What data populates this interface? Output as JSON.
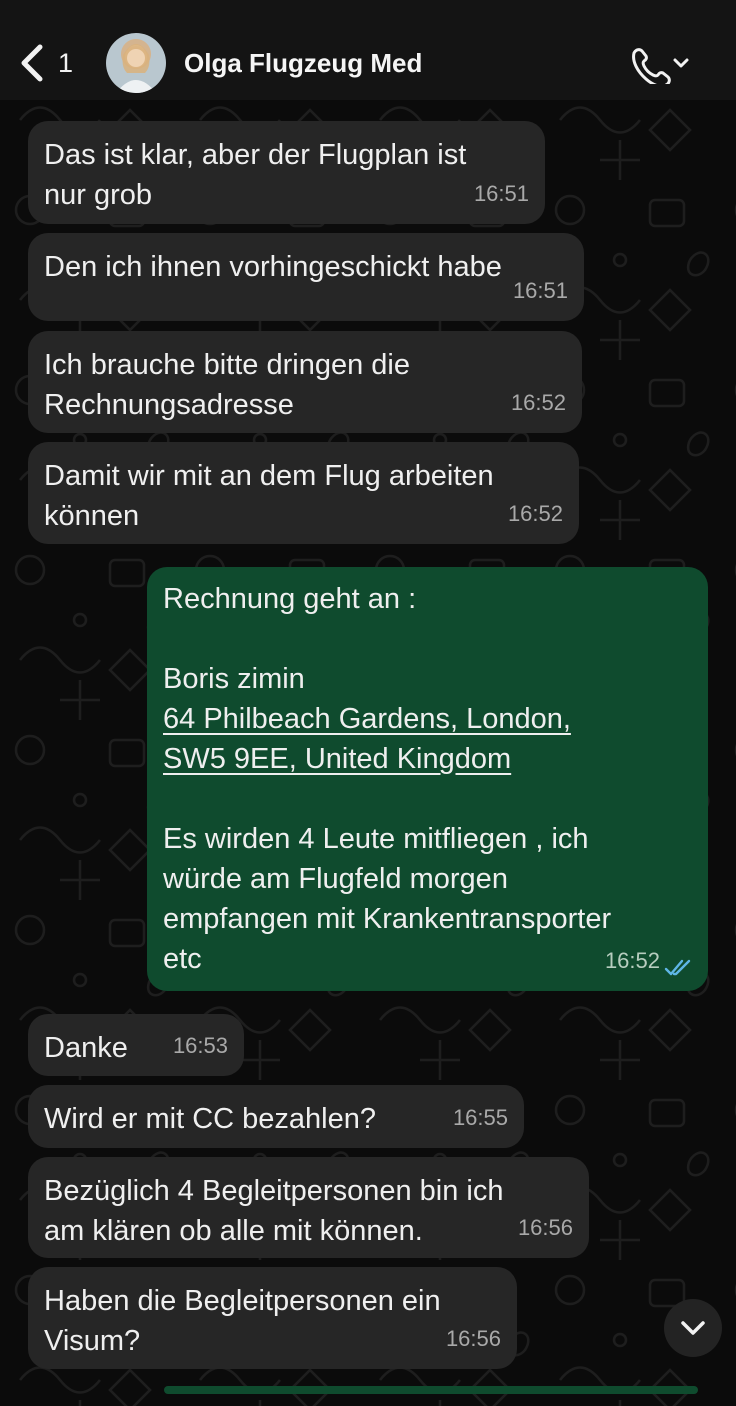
{
  "header": {
    "back_count": "1",
    "contact_name": "Olga Flugzeug Med"
  },
  "messages": [
    {
      "text": "Das ist klar, aber der Flugplan ist\nnur grob",
      "time": "16:51"
    },
    {
      "text": "Den ich ihnen vorhingeschickt habe",
      "time": "16:51"
    },
    {
      "text": "Ich brauche bitte dringen die\nRechnungsadresse",
      "time": "16:52"
    },
    {
      "text": "Damit wir mit an dem Flug arbeiten\nkönnen",
      "time": "16:52"
    },
    {
      "intro": "Rechnung geht an :",
      "name": "Boris zimin",
      "address_line1": "64 Philbeach Gardens, London,",
      "address_line2": "SW5 9EE, United Kingdom",
      "body": "Es wirden 4 Leute mitfliegen , ich\nwürde am Flugfeld morgen\nempfangen mit  Krankentransporter\netc",
      "time": "16:52"
    },
    {
      "text": "Danke",
      "time": "16:53"
    },
    {
      "text": "Wird er mit CC bezahlen?",
      "time": "16:55"
    },
    {
      "text": "Bezüglich 4 Begleitpersonen bin ich\nam klären ob alle mit können.",
      "time": "16:56"
    },
    {
      "text": "Haben die Begleitpersonen ein\nVisum?",
      "time": "16:56"
    }
  ],
  "colors": {
    "background": "#0b0b0b",
    "incoming_bubble": "#262626",
    "outgoing_bubble": "#0f4b2e",
    "read_receipt": "#5fb6e6"
  },
  "icons": {
    "back": "chevron-left-icon",
    "call": "phone-icon",
    "call_menu": "chevron-down-icon",
    "read": "double-check-icon",
    "scroll": "chevron-down-icon"
  }
}
